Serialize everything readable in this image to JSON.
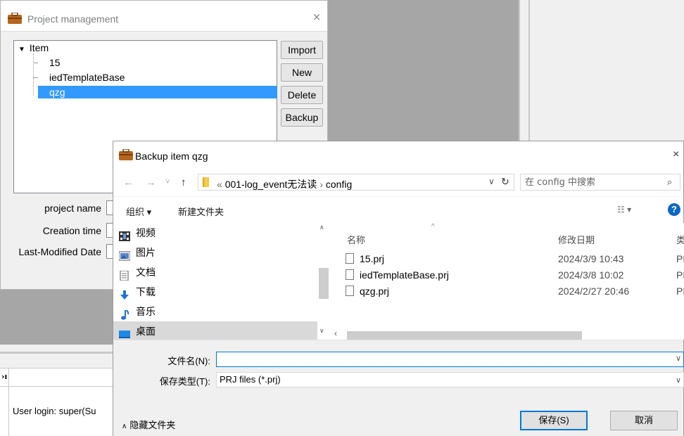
{
  "project_window": {
    "title": "Project management",
    "close": "×",
    "tree": {
      "root": "Item",
      "items": [
        "15",
        "iedTemplateBase",
        "qzg"
      ],
      "selected_index": 2
    },
    "buttons": {
      "import": "Import",
      "new": "New",
      "delete": "Delete",
      "backup": "Backup"
    },
    "fields": {
      "project_name_label": "project name",
      "creation_time_label": "Creation time",
      "last_modified_label": "Last-Modified Date"
    }
  },
  "background": {
    "log_entry": "User login: super(Su"
  },
  "save_dialog": {
    "title": "Backup item qzg",
    "close": "×",
    "nav": {
      "back": "←",
      "forward": "→",
      "recent": "˅",
      "up": "↑"
    },
    "address": {
      "prefix": "«",
      "crumb_parent": "001-log_event无法读",
      "separator": "›",
      "crumb_current": "config",
      "dropdown": "∨",
      "refresh": "↻"
    },
    "search": {
      "placeholder": "在 config 中搜索",
      "icon": "⌕"
    },
    "toolbar": {
      "organize": "组织 ▾",
      "new_folder": "新建文件夹",
      "view": "☷ ▾",
      "help": "?"
    },
    "nav_pane": {
      "items": [
        {
          "label": "视频",
          "icon": "video-icon"
        },
        {
          "label": "图片",
          "icon": "pictures-icon"
        },
        {
          "label": "文档",
          "icon": "documents-icon"
        },
        {
          "label": "下载",
          "icon": "downloads-icon"
        },
        {
          "label": "音乐",
          "icon": "music-icon"
        },
        {
          "label": "桌面",
          "icon": "desktop-icon"
        }
      ],
      "selected_index": 5
    },
    "columns": {
      "name": "名称",
      "modified": "修改日期",
      "type": "类"
    },
    "files": [
      {
        "name": "15.prj",
        "modified": "2024/3/9 10:43",
        "type": "PF"
      },
      {
        "name": "iedTemplateBase.prj",
        "modified": "2024/3/8 10:02",
        "type": "PF"
      },
      {
        "name": "qzg.prj",
        "modified": "2024/2/27 20:46",
        "type": "PF"
      }
    ],
    "filename_label": "文件名(N):",
    "filename_value": "",
    "filetype_label": "保存类型(T):",
    "filetype_value": "PRJ files (*.prj)",
    "hide_folders": "隐藏文件夹",
    "save_button": "保存(S)",
    "cancel_button": "取消"
  },
  "colors": {
    "selection": "#3399ff",
    "accent": "#0078d7",
    "nav_selected": "#d9d9d9",
    "overlay_gray": "#a6a6a6"
  }
}
